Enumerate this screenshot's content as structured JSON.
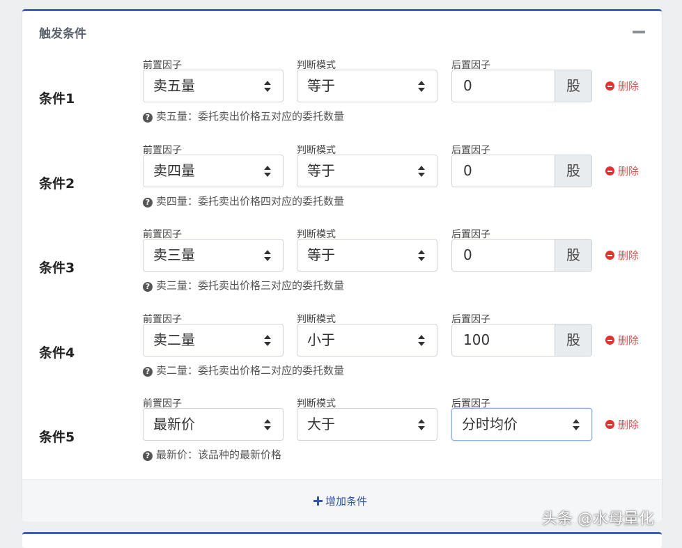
{
  "panel": {
    "title": "触发条件",
    "add_label": "增加条件"
  },
  "labels": {
    "pre": "前置因子",
    "mode": "判断模式",
    "post": "后置因子",
    "delete": "删除"
  },
  "conditions": [
    {
      "name": "条件1",
      "pre": "卖五量",
      "mode": "等于",
      "post_value": "0",
      "unit": "股",
      "help": "卖五量：委托卖出价格五对应的委托数量"
    },
    {
      "name": "条件2",
      "pre": "卖四量",
      "mode": "等于",
      "post_value": "0",
      "unit": "股",
      "help": "卖四量：委托卖出价格四对应的委托数量"
    },
    {
      "name": "条件3",
      "pre": "卖三量",
      "mode": "等于",
      "post_value": "0",
      "unit": "股",
      "help": "卖三量：委托卖出价格三对应的委托数量"
    },
    {
      "name": "条件4",
      "pre": "卖二量",
      "mode": "小于",
      "post_value": "100",
      "unit": "股",
      "help": "卖二量：委托卖出价格二对应的委托数量"
    },
    {
      "name": "条件5",
      "pre": "最新价",
      "mode": "大于",
      "post_select": "分时均价",
      "help": "最新价：该品种的最新价格"
    }
  ],
  "watermark": "头条 @水母量化",
  "colors": {
    "accent": "#3c60b5",
    "danger": "#e0332f",
    "link": "#2f55a8"
  }
}
